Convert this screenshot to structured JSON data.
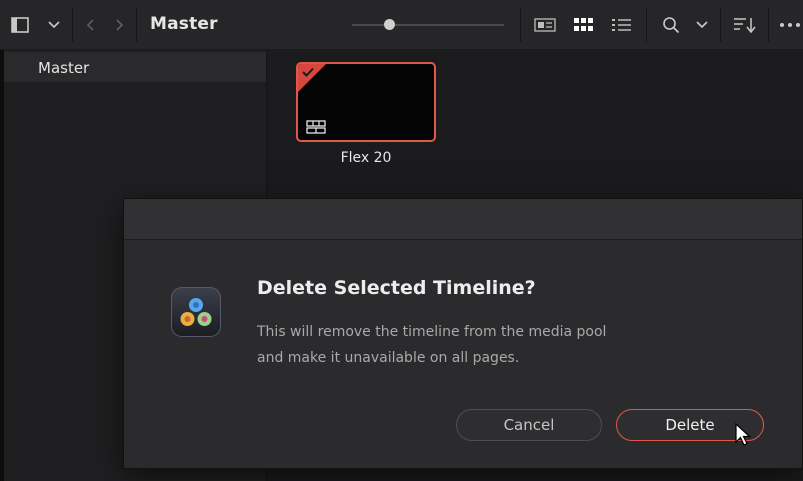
{
  "toolbar": {
    "title": "Master",
    "slider_level": 0.21,
    "icons": [
      "panel-toggle-icon",
      "chevron-down-icon",
      "back-icon",
      "forward-icon",
      "metadata-view-icon",
      "thumbnail-view-icon",
      "list-view-icon",
      "search-icon",
      "chevron-down-icon",
      "sort-icon",
      "more-options-icon"
    ]
  },
  "sidebar": {
    "items": [
      {
        "label": "Master",
        "selected": true
      }
    ]
  },
  "media_pool": {
    "clips": [
      {
        "name": "Flex 20",
        "type": "timeline",
        "selected": true
      }
    ]
  },
  "dialog": {
    "title": "Delete Selected Timeline?",
    "message_line1": "This will remove the timeline from the media pool",
    "message_line2": "and make it unavailable on all pages.",
    "cancel_label": "Cancel",
    "delete_label": "Delete",
    "icon": "davinci-resolve-app-icon"
  },
  "colors": {
    "accent_red": "#e0574b",
    "background": "#1b1b1d",
    "dialog_bg": "#2b2b2e"
  }
}
